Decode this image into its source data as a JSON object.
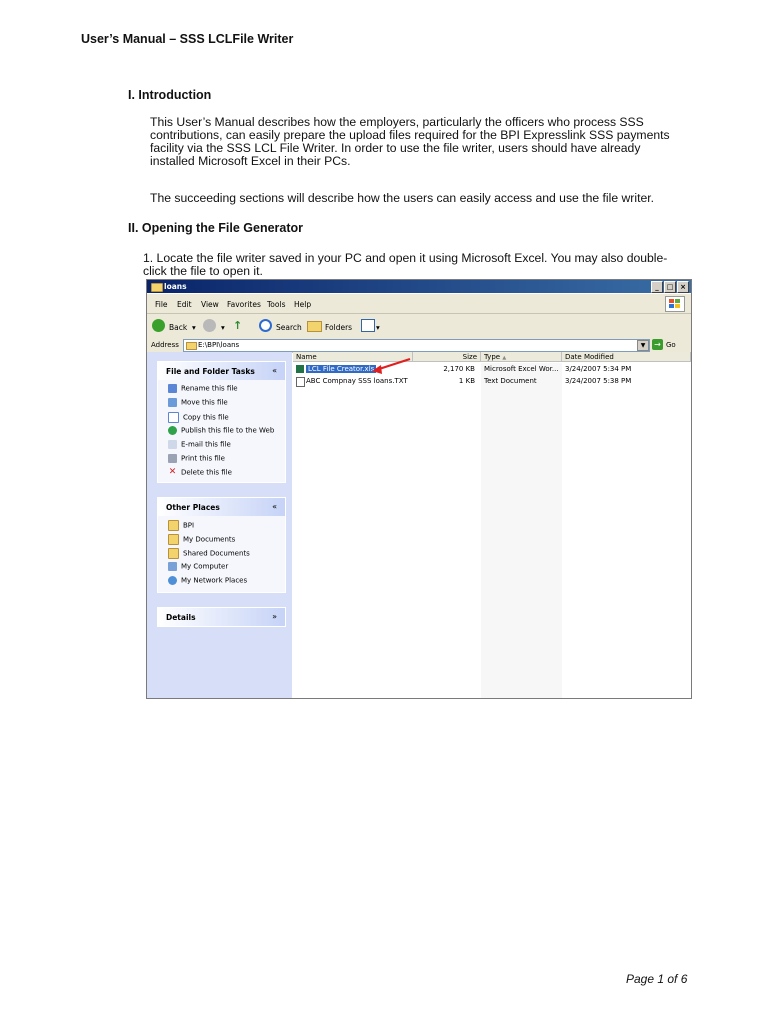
{
  "header": {
    "title": "User’s Manual – SSS LCLFile Writer"
  },
  "sections": [
    {
      "heading": "I. Introduction",
      "paragraphs": [
        [
          "This User’s Manual describes how the employers, particularly the officers who process SSS",
          "contributions, can easily prepare the upload files required for the BPI Expresslink SSS payments",
          "facility via the SSS LCL File Writer.  In order to use the file writer, users should have already",
          "installed Microsoft Excel in their PCs."
        ],
        [
          "The succeeding sections will describe how the users can easily access and use the file writer."
        ]
      ]
    },
    {
      "heading": "II. Opening the File Generator",
      "step": [
        "1. Locate the file writer saved in your PC and open it using Microsoft Excel.  You may also double-",
        "click the file to open it."
      ]
    }
  ],
  "explorer": {
    "title": "loans",
    "menu": [
      "File",
      "Edit",
      "View",
      "Favorites",
      "Tools",
      "Help"
    ],
    "toolbar": {
      "back": "Back",
      "search": "Search",
      "folders": "Folders"
    },
    "address": {
      "label": "Address",
      "value": "E:\\BPI\\loans",
      "go": "Go"
    },
    "task_panels": [
      {
        "title": "File and Folder Tasks",
        "chevron": "«",
        "items": [
          "Rename this file",
          "Move this file",
          "Copy this file",
          "Publish this file to the Web",
          "E-mail this file",
          "Print this file",
          "Delete this file"
        ]
      },
      {
        "title": "Other Places",
        "chevron": "«",
        "items": [
          "BPI",
          "My Documents",
          "Shared Documents",
          "My Computer",
          "My Network Places"
        ]
      },
      {
        "title": "Details",
        "chevron": "»",
        "items": []
      }
    ],
    "columns": [
      "Name",
      "Size",
      "Type",
      "Date Modified"
    ],
    "sort_indicator": "▲",
    "files": [
      {
        "name": "LCL File Creator.xls",
        "size": "2,170 KB",
        "type": "Microsoft Excel Wor...",
        "modified": "3/24/2007 5:34 PM",
        "selected": true
      },
      {
        "name": "ABC Compnay SSS loans.TXT",
        "size": "1 KB",
        "type": "Text Document",
        "modified": "3/24/2007 5:38 PM",
        "selected": false
      }
    ],
    "colors": {
      "titlebar": "#0a246a",
      "selection": "#316ac5",
      "taskpane": "#d6dff7",
      "arrow": "#e02020"
    }
  },
  "footer": {
    "page": "Page 1 of 6"
  }
}
